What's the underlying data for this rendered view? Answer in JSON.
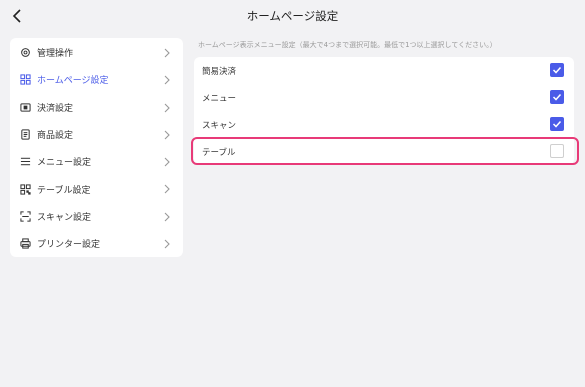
{
  "header": {
    "title": "ホームページ設定",
    "back_icon": "chevron-left-icon"
  },
  "sidebar": {
    "items": [
      {
        "label": "管理操作",
        "icon": "gear-icon",
        "active": false
      },
      {
        "label": "ホームページ設定",
        "icon": "grid-icon",
        "active": true
      },
      {
        "label": "決済設定",
        "icon": "payment-icon",
        "active": false
      },
      {
        "label": "商品設定",
        "icon": "document-icon",
        "active": false
      },
      {
        "label": "メニュー設定",
        "icon": "menu-icon",
        "active": false
      },
      {
        "label": "テーブル設定",
        "icon": "qr-code-icon",
        "active": false
      },
      {
        "label": "スキャン設定",
        "icon": "scan-icon",
        "active": false
      },
      {
        "label": "プリンター設定",
        "icon": "printer-icon",
        "active": false
      }
    ]
  },
  "main": {
    "hint": "ホームページ表示メニュー設定（最大で4つまで選択可能。最低で1つ以上選択してください。）",
    "options": [
      {
        "label": "簡易決済",
        "checked": true
      },
      {
        "label": "メニュー",
        "checked": true
      },
      {
        "label": "スキャン",
        "checked": true
      },
      {
        "label": "テーブル",
        "checked": false
      }
    ]
  },
  "colors": {
    "accent": "#4a5be8",
    "highlight": "#e83a78",
    "background": "#f2f2f4"
  }
}
